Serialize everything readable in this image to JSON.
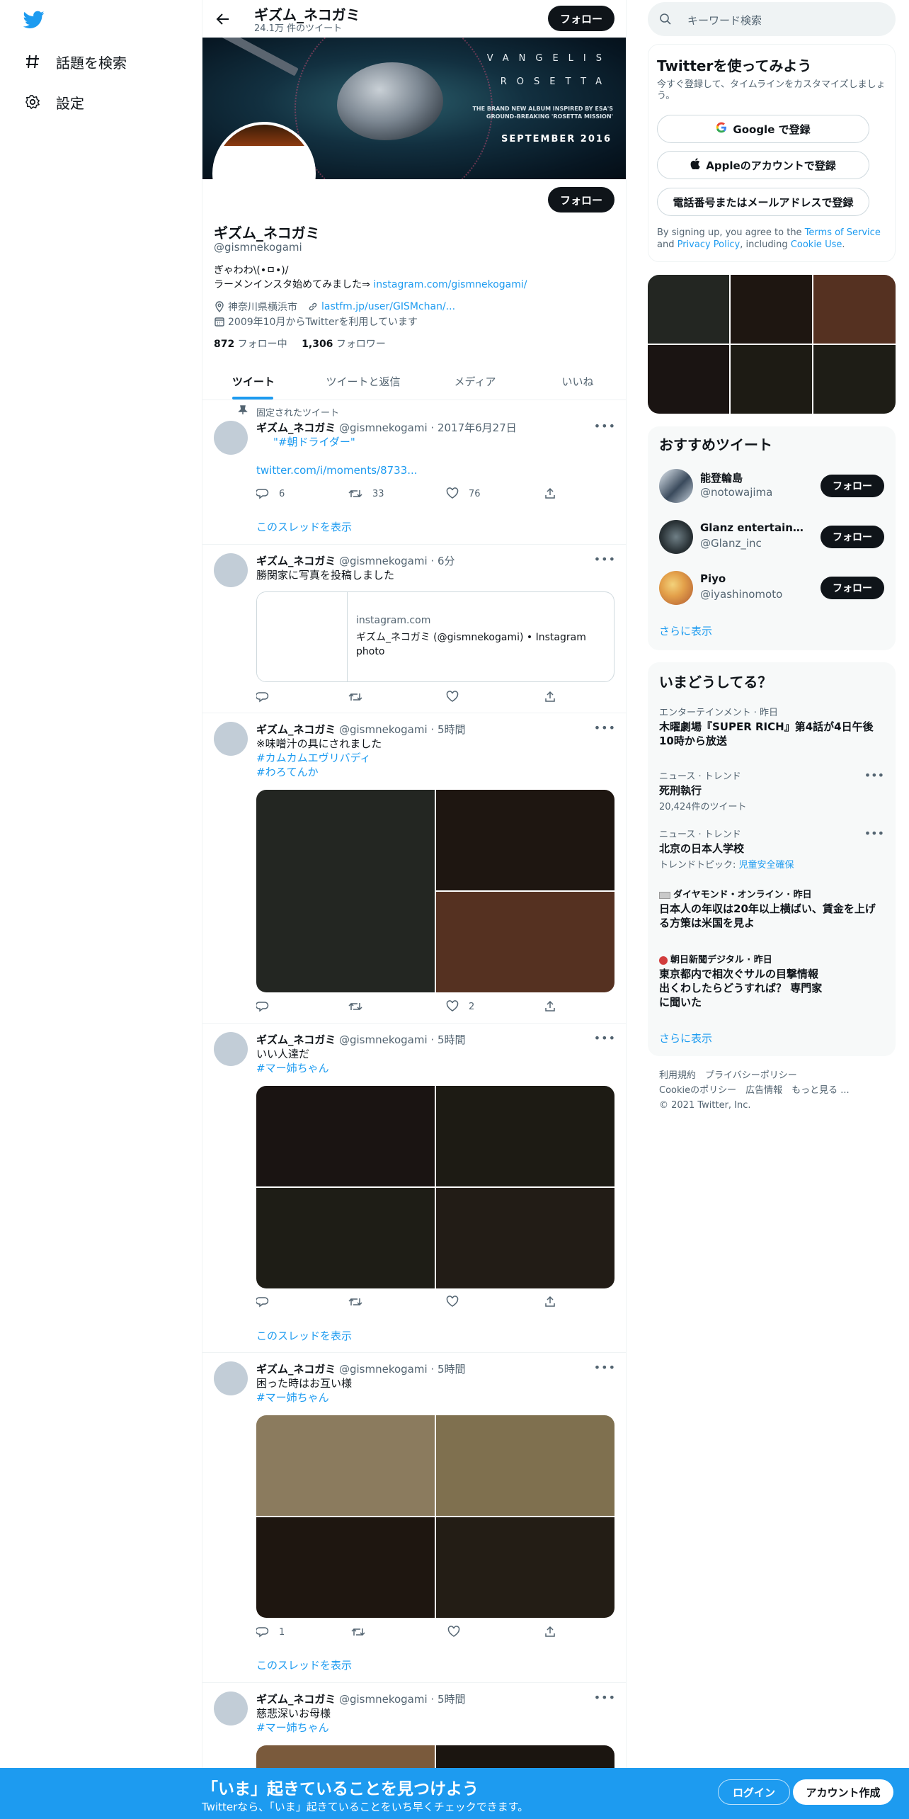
{
  "nav": {
    "explore": "話題を検索",
    "settings": "設定"
  },
  "header": {
    "name": "ギズム_ネコガミ",
    "tweet_count": "24.1万 件のツイート",
    "follow": "フォロー"
  },
  "banner": {
    "line1": "VANGELIS",
    "line2": "ROSETTA",
    "line3": "THE BRAND NEW ALBUM INSPIRED BY ESA'S GROUND-BREAKING 'ROSETTA MISSION'",
    "line4": "SEPTEMBER 2016"
  },
  "profile": {
    "name": "ギズム_ネコガミ",
    "handle": "@gismnekogami",
    "follow": "フォロー",
    "bio_line1": "ぎゃわわ\\(•ㅁ•)/",
    "bio_line2": "ラーメンインスタ始めてみました⇒ ",
    "bio_link": "instagram.com/gismnekogami/",
    "location": "神奈川県横浜市",
    "website": "lastfm.jp/user/GISMchan/...",
    "joined": "2009年10月からTwitterを利用しています",
    "following_count": "872",
    "following_label": " フォロー中",
    "followers_count": "1,306",
    "followers_label": " フォロワー"
  },
  "tabs": [
    "ツイート",
    "ツイートと返信",
    "メディア",
    "いいね"
  ],
  "tweets": [
    {
      "pinned": "固定されたツイート",
      "name": "ギズム_ネコガミ",
      "meta": "@gismnekogami · 2017年6月27日",
      "text_line1": "\"#朝ドライダー\"",
      "link": "twitter.com/i/moments/8733...",
      "reply": "6",
      "retweet": "33",
      "like": "76",
      "show_thread": "このスレッドを表示"
    },
    {
      "name": "ギズム_ネコガミ",
      "meta": "@gismnekogami · 6分",
      "text_line1": "勝関家に写真を投稿しました",
      "card_domain": "instagram.com",
      "card_title": "ギズム_ネコガミ (@gismnekogami) • Instagram photo"
    },
    {
      "name": "ギズム_ネコガミ",
      "meta": "@gismnekogami · 5時間",
      "text_line1": "※味噌汁の具にされました",
      "tag1": "#カムカムエヴリバディ",
      "tag2": "#わろてんか",
      "like": "2"
    },
    {
      "name": "ギズム_ネコガミ",
      "meta": "@gismnekogami · 5時間",
      "text_line1": "いい人達だ",
      "tag1": "#マー姉ちゃん",
      "show_thread": "このスレッドを表示"
    },
    {
      "name": "ギズム_ネコガミ",
      "meta": "@gismnekogami · 5時間",
      "text_line1": "困った時はお互い様",
      "tag1": "#マー姉ちゃん",
      "reply": "1",
      "show_thread": "このスレッドを表示"
    },
    {
      "name": "ギズム_ネコガミ",
      "meta": "@gismnekogami · 5時間",
      "text_line1": "慈悲深いお母様",
      "tag1": "#マー姉ちゃん"
    }
  ],
  "search": {
    "placeholder": "キーワード検索"
  },
  "signup": {
    "title": "Twitterを使ってみよう",
    "subtitle": "今すぐ登録して、タイムラインをカスタマイズしましょう。",
    "google": "Google で登録",
    "apple": "Appleのアカウントで登録",
    "phone": "電話番号またはメールアドレスで登録",
    "terms_pre": "By signing up, you agree to the ",
    "terms_tos": "Terms of Service",
    "terms_and": " and ",
    "terms_privacy": "Privacy Policy",
    "terms_mid": ", including ",
    "terms_cookie": "Cookie Use",
    "terms_end": "."
  },
  "recommended": {
    "title": "おすすめツイート",
    "items": [
      {
        "name": "能登輪島",
        "handle": "@notowajima",
        "follow": "フォロー"
      },
      {
        "name": "Glanz entertainment...",
        "handle": "@Glanz_inc",
        "follow": "フォロー"
      },
      {
        "name": "Piyo",
        "handle": "@iyashinomoto",
        "follow": "フォロー"
      }
    ],
    "more": "さらに表示"
  },
  "trends": {
    "title": "いまどうしてる？",
    "items": [
      {
        "context": "エンターテインメント · 昨日",
        "title": "木曜劇場『SUPER RICH』第4話が4日午後10時から放送"
      },
      {
        "context": "ニュース · トレンド",
        "title": "死刑執行",
        "sub": "20,424件のツイート"
      },
      {
        "context": "ニュース · トレンド",
        "title": "北京の日本人学校",
        "sub_pre": "トレンドトピック: ",
        "sub_link": "児童安全確保"
      },
      {
        "context": "ダイヤモンド・オンライン · 昨日",
        "title": "日本人の年収は20年以上横ばい、賃金を上げる方策は米国を見よ"
      },
      {
        "context": "朝日新聞デジタル · 昨日",
        "title": "東京都内で相次ぐサルの目撃情報　出くわしたらどうすれば？ 専門家に聞いた"
      }
    ],
    "more": "さらに表示"
  },
  "footer": {
    "line1": "利用規約　プライバシーポリシー",
    "line2": "Cookieのポリシー　広告情報　もっと見る ...",
    "line3": "© 2021 Twitter, Inc."
  },
  "bottom": {
    "headline": "「いま」起きていることを見つけよう",
    "sub": "Twitterなら、「いま」起きていることをいち早くチェックできます。",
    "login": "ログイン",
    "signup": "アカウント作成"
  }
}
